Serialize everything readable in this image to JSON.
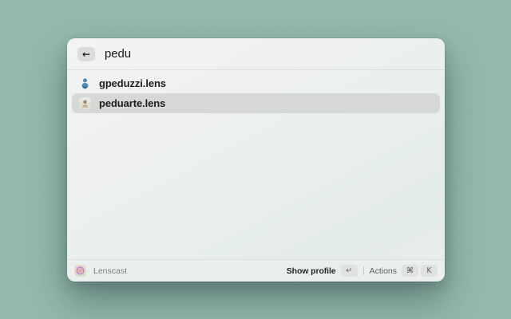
{
  "background": {
    "style": "mesh-gradient-wallpaper",
    "colors": [
      "#faf3c4",
      "#f09e8a",
      "#227048",
      "#f3dbee",
      "#20c4ec",
      "#1872d8",
      "#1c8a96"
    ]
  },
  "window": {
    "search": {
      "back_icon": "←",
      "query": "pedu"
    },
    "results": [
      {
        "icon": "blue-person-avatar",
        "label": "gpeduzzi.lens",
        "selected": false
      },
      {
        "icon": "photo-avatar",
        "label": "peduarte.lens",
        "selected": true
      }
    ],
    "footer": {
      "app_icon": "lenscast-ring-icon",
      "app_name": "Lenscast",
      "primary_action_label": "Show profile",
      "primary_action_key": "↵",
      "actions_label": "Actions",
      "actions_keys": [
        "⌘",
        "K"
      ]
    },
    "colors": {
      "selection_bg": "#d6d8d5",
      "keycap_bg": "#e0e2df",
      "avatar_blue": "#4e8cb4"
    }
  }
}
